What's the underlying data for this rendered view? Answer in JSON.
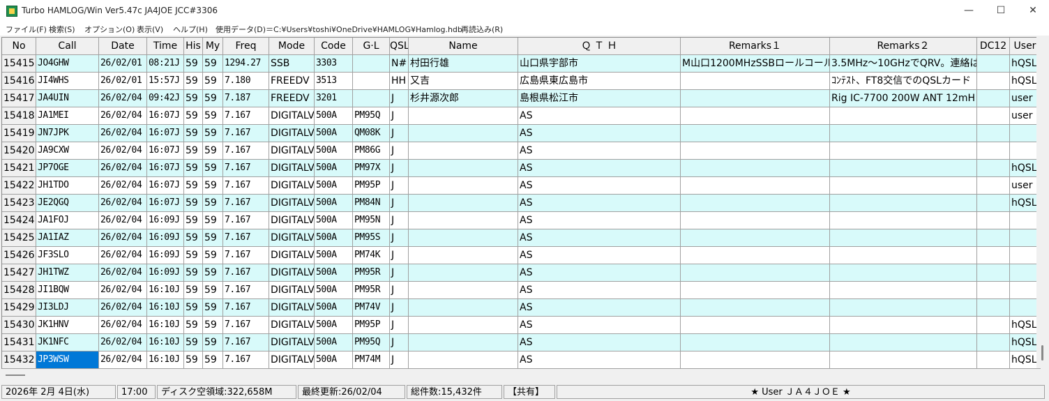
{
  "window": {
    "title": "Turbo HAMLOG/Win Ver5.47c JA4JOE JCC#3306",
    "minimize_glyph": "—",
    "maximize_glyph": "☐",
    "close_glyph": "✕"
  },
  "menu": [
    "ファイル(F)",
    "検索(S)",
    "オプション(O)",
    "表示(V)",
    "ヘルプ(H)",
    "使用データ(D)＝C:¥Users¥toshi¥OneDrive¥HAMLOG¥Hamlog.hdb",
    "再読込み(R)"
  ],
  "columns": [
    "No",
    "Call",
    "Date",
    "Time",
    "His",
    "My",
    "Freq",
    "Mode",
    "Code",
    "G·L",
    "QSL",
    "Name",
    "Ｑ Ｔ Ｈ",
    "Remarks１",
    "Remarks２",
    "DC12",
    "User"
  ],
  "rows": [
    [
      "15415",
      "JO4GHW",
      "26/02/01",
      "08:21J",
      "59",
      "59",
      "1294.27",
      "SSB",
      "3303",
      "",
      "N#",
      "村田行雄",
      "山口県宇部市",
      "M山口1200MHzSSBロールコール",
      "3.5MHz～10GHzでQRV。連絡は",
      "",
      "hQSL"
    ],
    [
      "15416",
      "JI4WHS",
      "26/02/01",
      "15:57J",
      "59",
      "59",
      "7.180",
      "FREEDV",
      "3513",
      "",
      "HH",
      "又吉",
      "広島県東広島市",
      "",
      "ｺﾝﾃｽﾄ、FT8交信でのQSLカード",
      "",
      "hQSL"
    ],
    [
      "15417",
      "JA4UIN",
      "26/02/04",
      "09:42J",
      "59",
      "59",
      "7.187",
      "FREEDV",
      "3201",
      "",
      "J",
      "杉井源次郎",
      "島根県松江市",
      "",
      "Rig IC-7700 200W ANT 12mH",
      "",
      "user"
    ],
    [
      "15418",
      "JA1MEI",
      "26/02/04",
      "16:07J",
      "59",
      "59",
      "7.167",
      "DIGITALV",
      "500A",
      "PM95Q",
      "J",
      "",
      "AS",
      "",
      "",
      "",
      "user"
    ],
    [
      "15419",
      "JN7JPK",
      "26/02/04",
      "16:07J",
      "59",
      "59",
      "7.167",
      "DIGITALV",
      "500A",
      "QM08K",
      "J",
      "",
      "AS",
      "",
      "",
      "",
      ""
    ],
    [
      "15420",
      "JA9CXW",
      "26/02/04",
      "16:07J",
      "59",
      "59",
      "7.167",
      "DIGITALV",
      "500A",
      "PM86G",
      "J",
      "",
      "AS",
      "",
      "",
      "",
      ""
    ],
    [
      "15421",
      "JP7OGE",
      "26/02/04",
      "16:07J",
      "59",
      "59",
      "7.167",
      "DIGITALV",
      "500A",
      "PM97X",
      "J",
      "",
      "AS",
      "",
      "",
      "",
      "hQSL"
    ],
    [
      "15422",
      "JH1TDO",
      "26/02/04",
      "16:07J",
      "59",
      "59",
      "7.167",
      "DIGITALV",
      "500A",
      "PM95P",
      "J",
      "",
      "AS",
      "",
      "",
      "",
      "user"
    ],
    [
      "15423",
      "JE2QGQ",
      "26/02/04",
      "16:07J",
      "59",
      "59",
      "7.167",
      "DIGITALV",
      "500A",
      "PM84N",
      "J",
      "",
      "AS",
      "",
      "",
      "",
      "hQSL"
    ],
    [
      "15424",
      "JA1FOJ",
      "26/02/04",
      "16:09J",
      "59",
      "59",
      "7.167",
      "DIGITALV",
      "500A",
      "PM95N",
      "J",
      "",
      "AS",
      "",
      "",
      "",
      ""
    ],
    [
      "15425",
      "JA1IAZ",
      "26/02/04",
      "16:09J",
      "59",
      "59",
      "7.167",
      "DIGITALV",
      "500A",
      "PM95S",
      "J",
      "",
      "AS",
      "",
      "",
      "",
      ""
    ],
    [
      "15426",
      "JF3SLO",
      "26/02/04",
      "16:09J",
      "59",
      "59",
      "7.167",
      "DIGITALV",
      "500A",
      "PM74K",
      "J",
      "",
      "AS",
      "",
      "",
      "",
      ""
    ],
    [
      "15427",
      "JH1TWZ",
      "26/02/04",
      "16:09J",
      "59",
      "59",
      "7.167",
      "DIGITALV",
      "500A",
      "PM95R",
      "J",
      "",
      "AS",
      "",
      "",
      "",
      ""
    ],
    [
      "15428",
      "JI1BQW",
      "26/02/04",
      "16:10J",
      "59",
      "59",
      "7.167",
      "DIGITALV",
      "500A",
      "PM95R",
      "J",
      "",
      "AS",
      "",
      "",
      "",
      ""
    ],
    [
      "15429",
      "JI3LDJ",
      "26/02/04",
      "16:10J",
      "59",
      "59",
      "7.167",
      "DIGITALV",
      "500A",
      "PM74V",
      "J",
      "",
      "AS",
      "",
      "",
      "",
      ""
    ],
    [
      "15430",
      "JK1HNV",
      "26/02/04",
      "16:10J",
      "59",
      "59",
      "7.167",
      "DIGITALV",
      "500A",
      "PM95P",
      "J",
      "",
      "AS",
      "",
      "",
      "",
      "hQSL"
    ],
    [
      "15431",
      "JK1NFC",
      "26/02/04",
      "16:10J",
      "59",
      "59",
      "7.167",
      "DIGITALV",
      "500A",
      "PM95Q",
      "J",
      "",
      "AS",
      "",
      "",
      "",
      "hQSL"
    ],
    [
      "15432",
      "JP3WSW",
      "26/02/04",
      "16:10J",
      "59",
      "59",
      "7.167",
      "DIGITALV",
      "500A",
      "PM74M",
      "J",
      "",
      "AS",
      "",
      "",
      "",
      "hQSL"
    ]
  ],
  "selected_row": 17,
  "selected_col": 1,
  "status": {
    "date": "2026年 2月 4日(水)",
    "time": "17:00",
    "disk": "ディスク空領域:322,658M",
    "updated": "最終更新:26/02/04",
    "total": "総件数:15,432件",
    "shared": "【共有】",
    "user": "★ User ＪＡ４ＪＯＥ ★"
  }
}
